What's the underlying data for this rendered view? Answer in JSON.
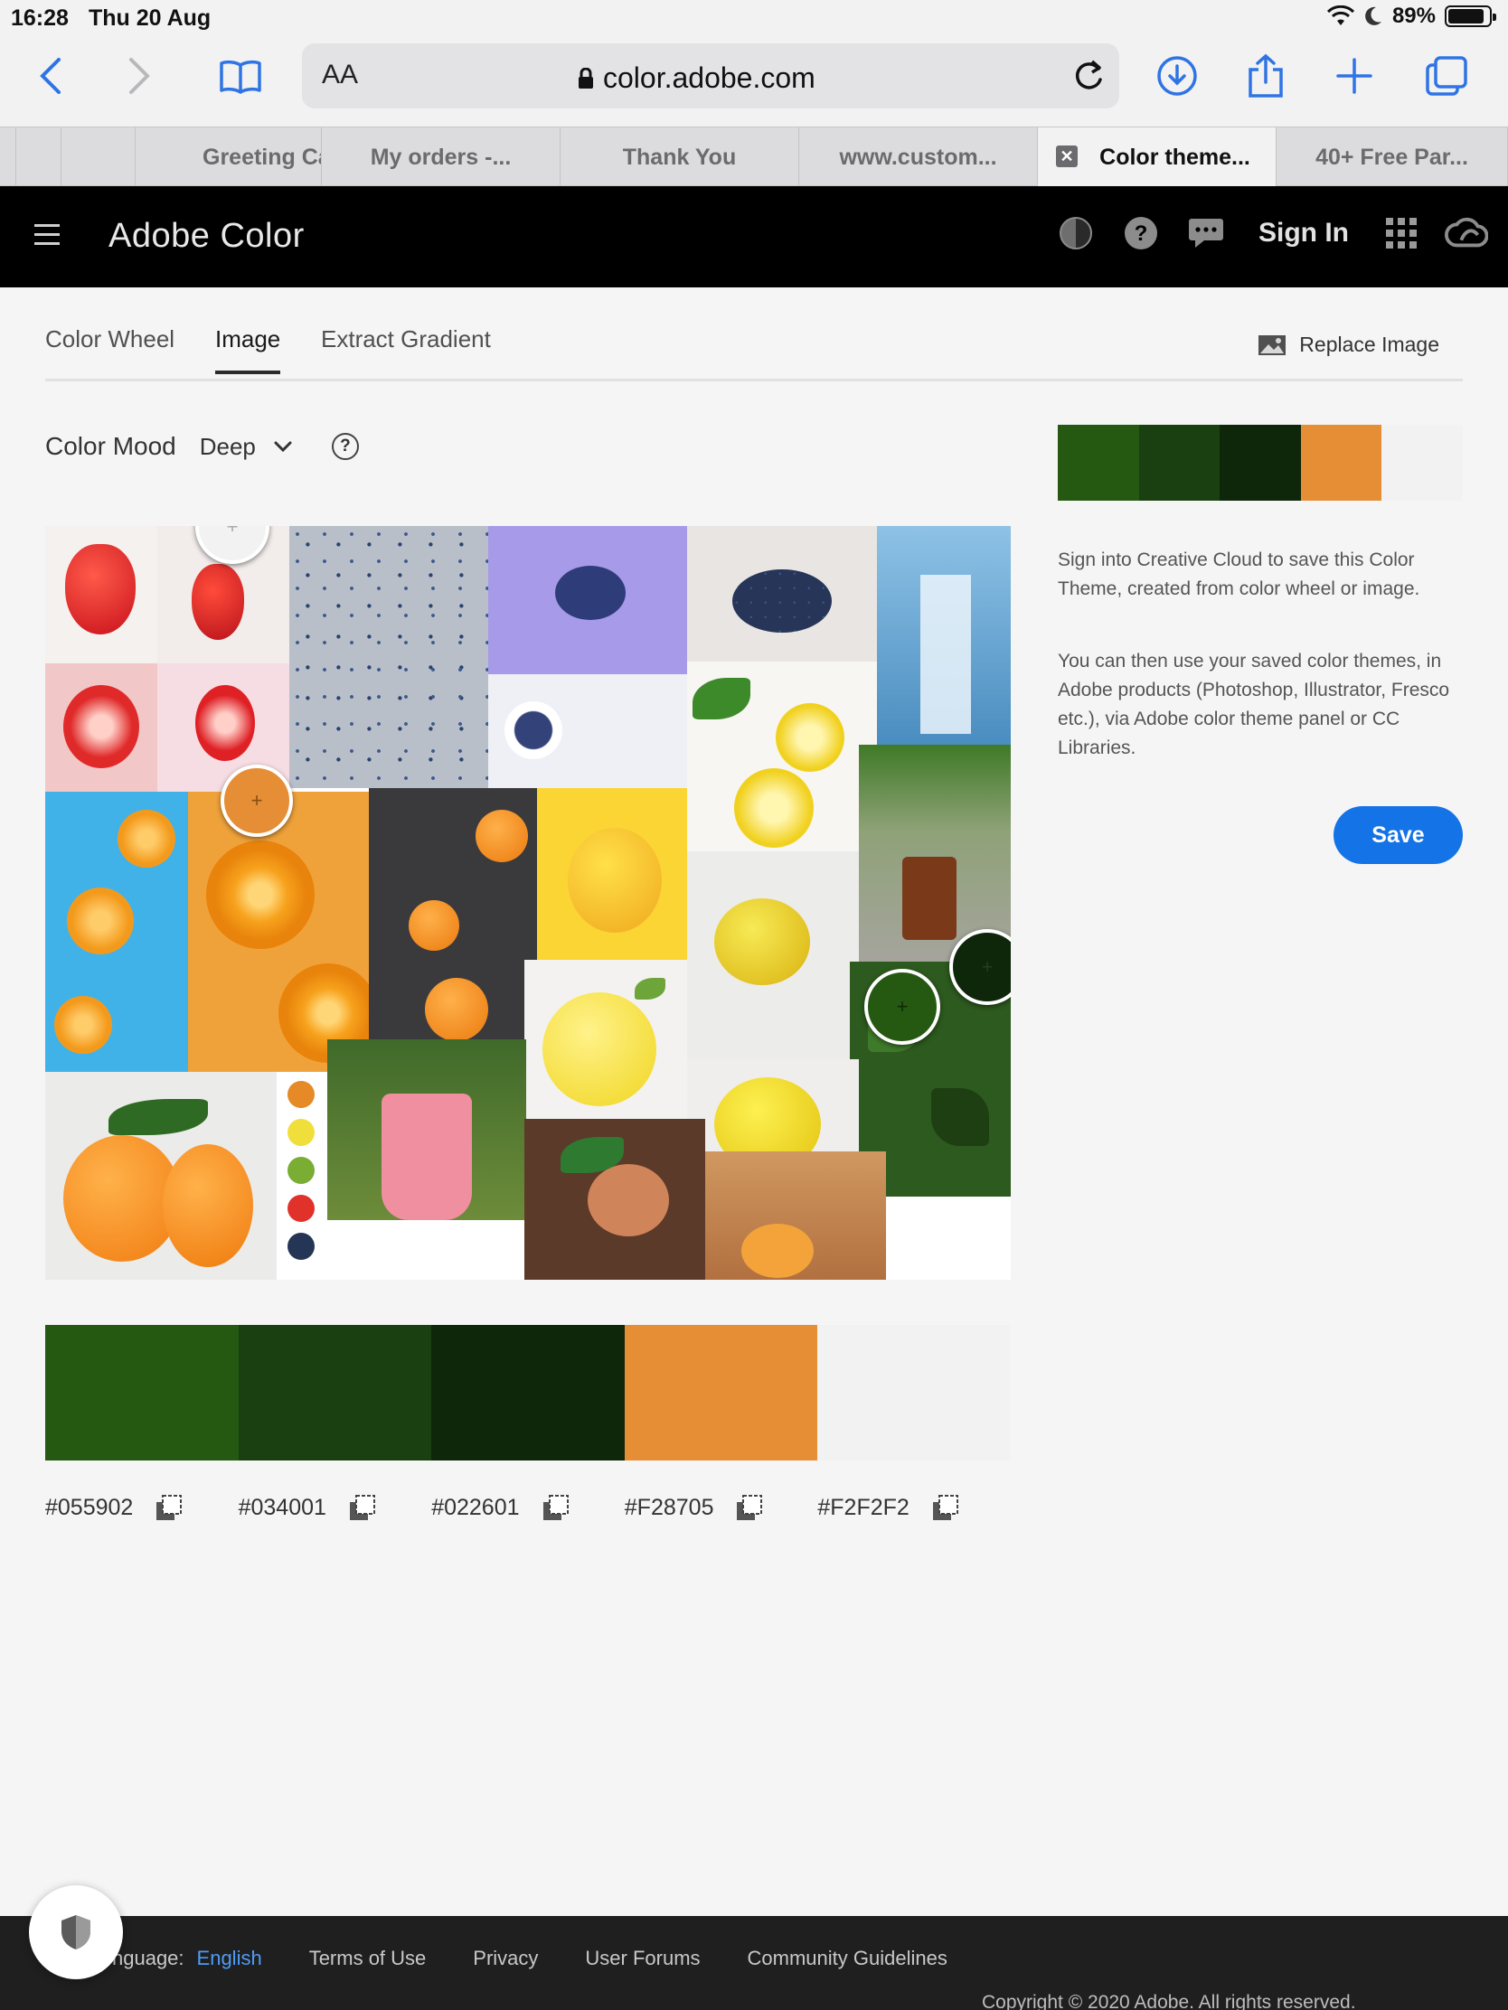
{
  "status": {
    "time": "16:28",
    "date": "Thu 20 Aug",
    "battery": "89%",
    "battery_level": 0.89
  },
  "browser": {
    "aa_label": "AA",
    "url": "color.adobe.com",
    "tabs": [
      "Greeting Ca",
      "My orders -...",
      "Thank You",
      "www.custom...",
      "Color theme...",
      "40+ Free Par..."
    ],
    "active_tab": 4
  },
  "header": {
    "brand": "Adobe Color",
    "sign_in": "Sign In"
  },
  "modes": {
    "tabs": [
      "Color Wheel",
      "Image",
      "Extract Gradient"
    ],
    "active": "Image",
    "replace_label": "Replace Image"
  },
  "mood": {
    "label": "Color Mood",
    "value": "Deep"
  },
  "theme": {
    "colors": [
      "#255912",
      "#1a4011",
      "#0e2609",
      "#e58e36",
      "#f2f2f2"
    ],
    "hex_codes": [
      "#055902",
      "#034001",
      "#022601",
      "#F28705",
      "#F2F2F2"
    ]
  },
  "side": {
    "info1": "Sign into Creative Cloud to save this Color Theme, created from color wheel or image.",
    "info2": "You can then use your saved color themes, in Adobe products (Photoshop, Illustrator, Fresco etc.), via Adobe color theme panel or CC Libraries.",
    "save_label": "Save"
  },
  "footer": {
    "language_label": "nguage:",
    "language_value": "English",
    "links": [
      "Terms of Use",
      "Privacy",
      "User Forums",
      "Community Guidelines"
    ],
    "copyright": "Copyright © 2020 Adobe. All rights reserved."
  }
}
